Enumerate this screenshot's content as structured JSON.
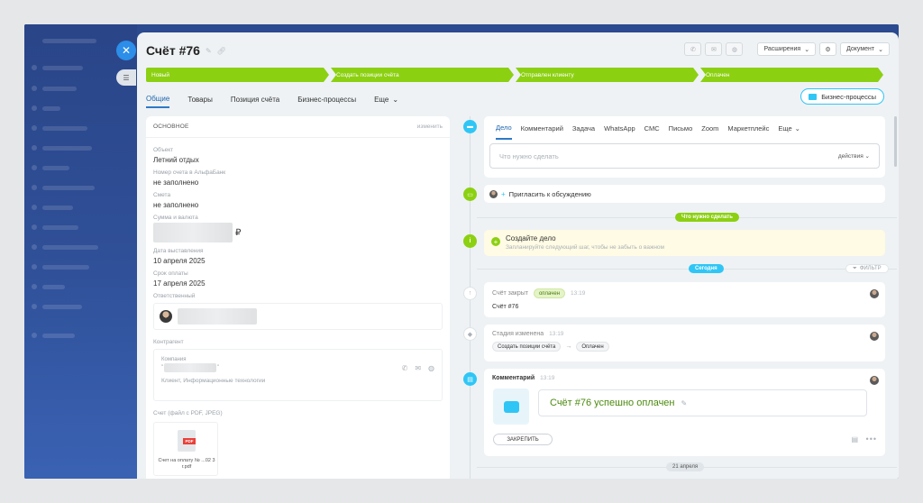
{
  "deal": {
    "title": "Счёт #76"
  },
  "top_actions": {
    "extensions": "Расширения",
    "document": "Документ"
  },
  "stages": [
    "Новый",
    "Создать позиции счёта",
    "Отправлен клиенту",
    "Оплачен"
  ],
  "tabs": [
    "Общие",
    "Товары",
    "Позиция счёта",
    "Бизнес-процессы",
    "Еще"
  ],
  "bp_button": "Бизнес-процессы",
  "left": {
    "section": "ОСНОВНОЕ",
    "edit": "изменить",
    "fields": {
      "object_label": "Объект",
      "object_value": "Летний отдых",
      "bank_label": "Номер счета в АльфаБанк",
      "bank_value": "не заполнено",
      "smeta_label": "Смета",
      "smeta_value": "не заполнено",
      "sum_label": "Сумма и валюта",
      "sum_currency": "₽",
      "date_label": "Дата выставления",
      "date_value": "10 апреля 2025",
      "due_label": "Срок оплаты",
      "due_value": "17 апреля 2025",
      "resp_label": "Ответственный",
      "contr_label": "Контрагент",
      "company_label": "Компания",
      "company_type": "Клиент, Информационные технологии",
      "file_label": "Счет (файл с PDF, JPEG)",
      "file_name": "Счет на оплату № ...02 3 г.pdf",
      "pdf_tag": "PDF"
    }
  },
  "activity": {
    "tabs": [
      "Дело",
      "Комментарий",
      "Задача",
      "WhatsApp",
      "СМС",
      "Письмо",
      "Zoom",
      "Маркетплейс",
      "Еще"
    ],
    "placeholder": "Что нужно сделать",
    "actions": "действия"
  },
  "invite": "Пригласить к обсуждению",
  "todo_pill": "Что нужно сделать",
  "create": {
    "title": "Создайте дело",
    "hint": "Запланируйте следующий шаг, чтобы не забыть о важном"
  },
  "today_pill": "Сегодня",
  "filter": "ФИЛЬТР",
  "events": {
    "closed": {
      "title": "Счёт закрыт",
      "badge": "оплачен",
      "time": "13:19",
      "body": "Счёт #76"
    },
    "stage": {
      "title": "Стадия изменена",
      "time": "13:19",
      "from": "Создать позиции счёта",
      "to": "Оплачен"
    },
    "comment": {
      "title": "Комментарий",
      "time": "13:19",
      "text": "Счёт #76 успешно оплачен",
      "pin": "ЗАКРЕПИТЬ"
    }
  },
  "date_pill": "21 апреля",
  "colors": {
    "stage_green": "#8cd012",
    "accent_blue": "#2fc6f6",
    "link_blue": "#2066b0"
  }
}
